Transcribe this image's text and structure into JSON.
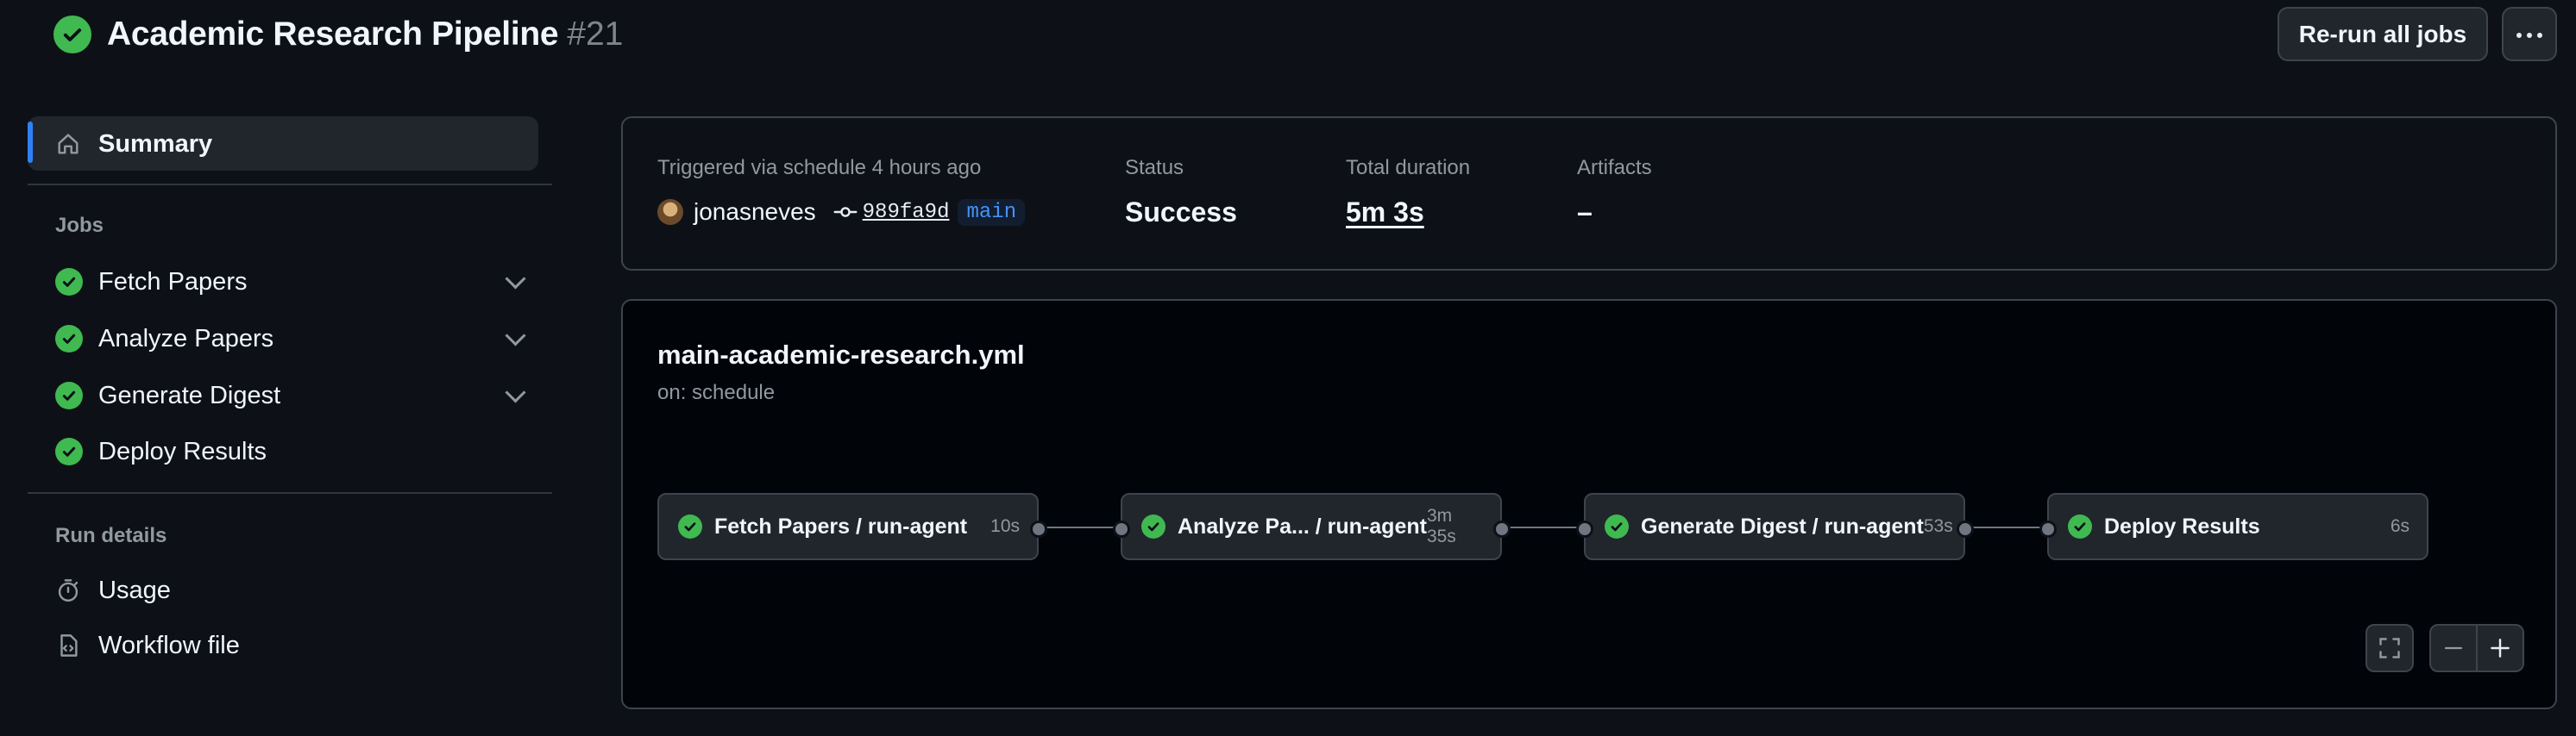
{
  "header": {
    "title": "Academic Research Pipeline",
    "run_number": "#21",
    "rerun_label": "Re-run all jobs",
    "more_icon": "kebab-horizontal-icon"
  },
  "sidebar": {
    "summary_label": "Summary",
    "jobs_heading": "Jobs",
    "jobs": [
      {
        "label": "Fetch Papers",
        "expandable": true
      },
      {
        "label": "Analyze Papers",
        "expandable": true
      },
      {
        "label": "Generate Digest",
        "expandable": true
      },
      {
        "label": "Deploy Results",
        "expandable": false
      }
    ],
    "run_details_heading": "Run details",
    "usage_label": "Usage",
    "workflow_file_label": "Workflow file"
  },
  "summary": {
    "trigger_text": "Triggered via schedule 4 hours ago",
    "actor": "jonasneves",
    "commit_sha": "989fa9d",
    "branch": "main",
    "status_label": "Status",
    "status_value": "Success",
    "duration_label": "Total duration",
    "duration_value": "5m 3s",
    "artifacts_label": "Artifacts",
    "artifacts_value": "–"
  },
  "workflow": {
    "file_name": "main-academic-research.yml",
    "trigger": "on: schedule",
    "jobs": [
      {
        "name": "Fetch Papers / run-agent",
        "duration": "10s"
      },
      {
        "name": "Analyze Pa... / run-agent",
        "duration": "3m 35s"
      },
      {
        "name": "Generate Digest / run-agent",
        "duration": "53s"
      },
      {
        "name": "Deploy Results",
        "duration": "6s"
      }
    ]
  },
  "colors": {
    "success": "#3fb950",
    "accent": "#2f81f7",
    "background": "#0d1117"
  }
}
